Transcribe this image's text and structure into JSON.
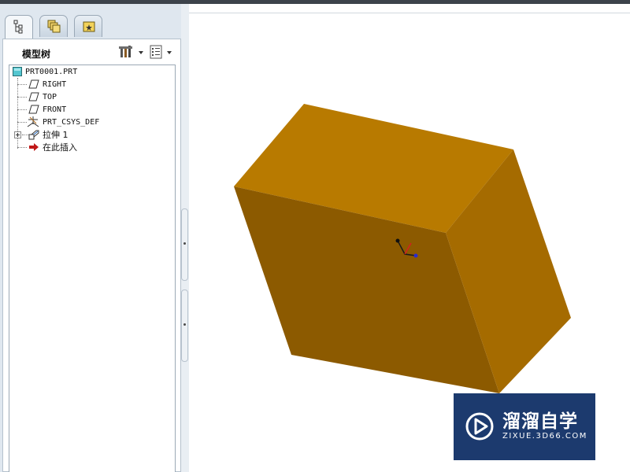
{
  "model_tree": {
    "title": "模型树",
    "tabs": [
      {
        "icon": "model-tree-tab-icon"
      },
      {
        "icon": "folder-browser-tab-icon"
      },
      {
        "icon": "favorites-tab-icon"
      }
    ],
    "tools": [
      {
        "icon": "tree-settings-icon"
      },
      {
        "icon": "show-list-icon"
      }
    ],
    "items": [
      {
        "label": "PRT0001.PRT",
        "icon": "part-icon"
      },
      {
        "label": "RIGHT",
        "icon": "datum-plane-icon"
      },
      {
        "label": "TOP",
        "icon": "datum-plane-icon"
      },
      {
        "label": "FRONT",
        "icon": "datum-plane-icon"
      },
      {
        "label": "PRT_CSYS_DEF",
        "icon": "coordinate-system-icon"
      },
      {
        "label": "拉伸 1",
        "icon": "extrude-icon"
      },
      {
        "label": "在此插入",
        "icon": "insert-here-arrow-icon"
      }
    ]
  },
  "viewport": {
    "model_color": "#b87a00",
    "face_colors": {
      "top": "#b87a00",
      "front": "#8c5a00",
      "right": "#a56b00"
    }
  },
  "watermark": {
    "brand": "溜溜自学",
    "url": "ZIXUE.3D66.COM",
    "color": "#1c3a6e"
  }
}
